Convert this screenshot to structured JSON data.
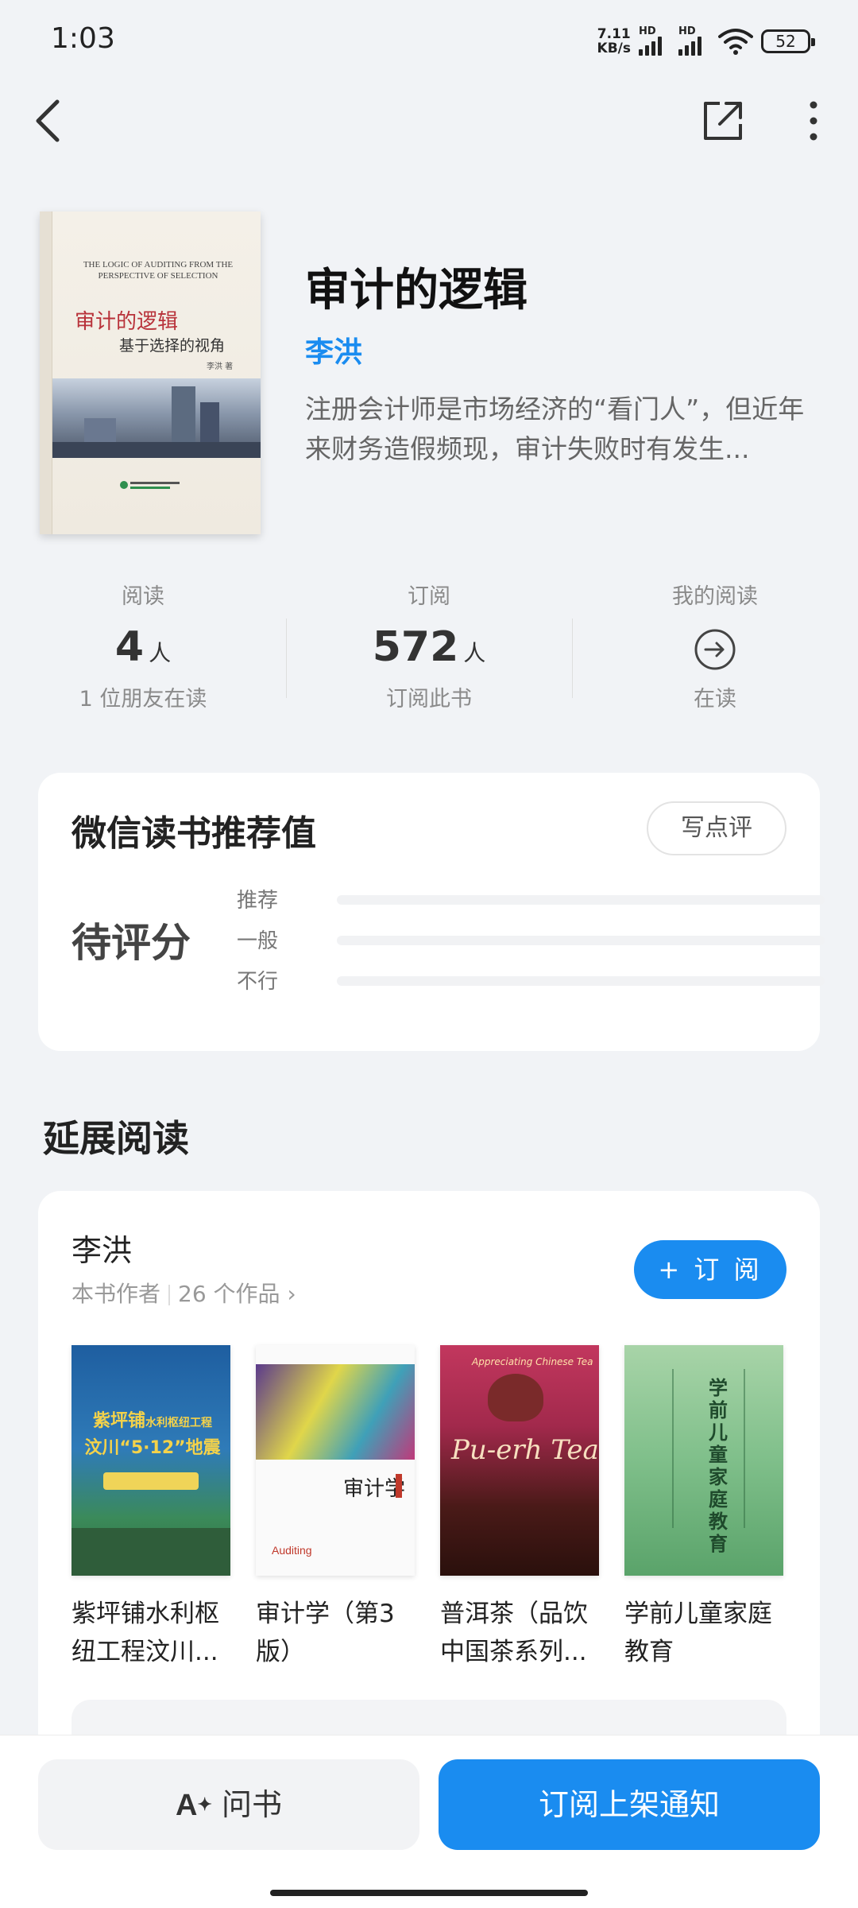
{
  "status_bar": {
    "time": "1:03",
    "net_speed_value": "7.11",
    "net_speed_unit": "KB/s",
    "hd1": "HD",
    "hd2": "HD",
    "battery": "52"
  },
  "book": {
    "title": "审计的逻辑",
    "author": "李洪",
    "description": "注册会计师是市场经济的“看门人”，但近年来财务造假频现，审计失败时有发生...",
    "cover": {
      "english_title": "THE LOGIC OF AUDITING FROM THE PERSPECTIVE OF SELECTION",
      "chinese_title": "审计的逻辑",
      "subtitle": "基于选择的视角",
      "author_mark": "李洪 著"
    }
  },
  "stats": {
    "read": {
      "label": "阅读",
      "value": "4",
      "unit": "人",
      "sub": "1 位朋友在读"
    },
    "subscribe": {
      "label": "订阅",
      "value": "572",
      "unit": "人",
      "sub": "订阅此书"
    },
    "my_reading": {
      "label": "我的阅读",
      "sub": "在读"
    }
  },
  "recommendation": {
    "title": "微信读书推荐值",
    "write_button": "写点评",
    "score_status": "待评分",
    "rows": [
      "推荐",
      "一般",
      "不行"
    ]
  },
  "extended_reading": {
    "title": "延展阅读",
    "author_name": "李洪",
    "author_role": "本书作者",
    "works_count": "26 个作品",
    "subscribe_button": "+ 订 阅",
    "books": [
      {
        "title": "紫坪铺水利枢纽工程汶川...",
        "cover_text": "紫坪铺水利枢纽工程\n汶川“5·12”地震"
      },
      {
        "title": "审计学（第3版）",
        "cover_text": "审计学"
      },
      {
        "title": "普洱茶（品饮中国茶系列...",
        "cover_text": "Pu-erh Tea"
      },
      {
        "title": "学前儿童家庭教育",
        "cover_text": "学前儿童家庭教育"
      }
    ]
  },
  "bottom_bar": {
    "ask_button": "问书",
    "notify_button": "订阅上架通知"
  },
  "colors": {
    "accent": "#1a8cf0",
    "background": "#f1f3f6",
    "cover_title": "#b8323a"
  }
}
